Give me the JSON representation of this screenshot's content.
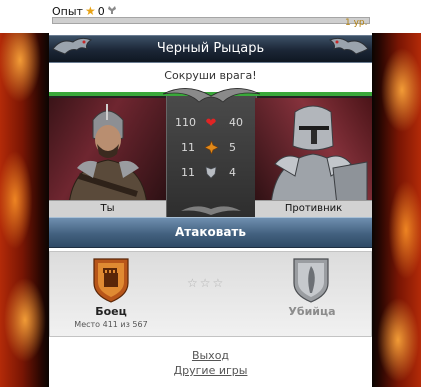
{
  "xp": {
    "label": "Опыт",
    "value": "0",
    "star_icon": "star-icon",
    "axe_icon": "axe-icon",
    "progress_fraction": 0.0,
    "level_label": "1 ур."
  },
  "title": "Черный Рыцарь",
  "subtitle": "Сокруши врага!",
  "player": {
    "name": "Ты"
  },
  "enemy": {
    "name": "Противник"
  },
  "stats": [
    {
      "icon": "heart-icon",
      "player": "110",
      "enemy": "40"
    },
    {
      "icon": "attack-icon",
      "player": "11",
      "enemy": "5"
    },
    {
      "icon": "defense-icon",
      "player": "11",
      "enemy": "4"
    }
  ],
  "attack_button": "Атаковать",
  "rank": {
    "player_rank": "Боец",
    "player_place": "Место 411 из 567",
    "enemy_rank": "Убийца",
    "stars": "☆☆☆"
  },
  "links": {
    "exit": "Выход",
    "other_games": "Другие игры"
  },
  "colors": {
    "health_bar": "#3aa83a",
    "title_bar": "#1b2636",
    "attack_bar": "#43617f",
    "fire": "#b32a08"
  }
}
